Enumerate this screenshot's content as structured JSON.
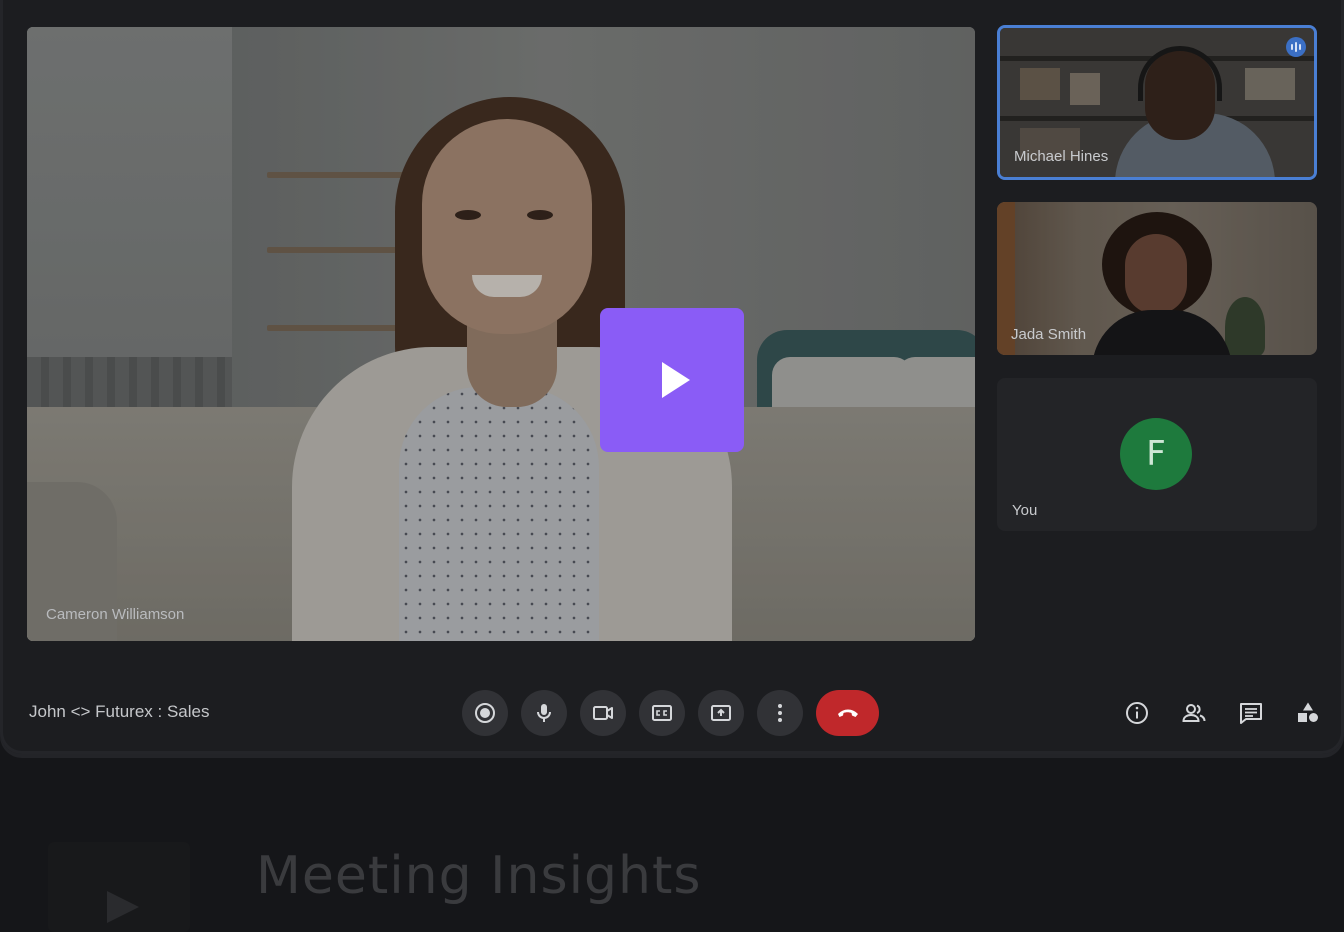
{
  "meeting": {
    "title": "John <> Futurex : Sales"
  },
  "main_video": {
    "participant": "Cameron Williamson"
  },
  "play_button": {
    "icon": "play-icon",
    "color": "#8a5cf6"
  },
  "participants": [
    {
      "name": "Michael Hines",
      "speaking": true
    },
    {
      "name": "Jada Smith",
      "speaking": false
    },
    {
      "name": "You",
      "avatar_letter": "F",
      "avatar_color": "#1e7a3d"
    }
  ],
  "controls": [
    {
      "name": "record",
      "icon": "record-icon"
    },
    {
      "name": "microphone",
      "icon": "microphone-icon"
    },
    {
      "name": "camera",
      "icon": "camera-icon"
    },
    {
      "name": "captions",
      "icon": "captions-icon"
    },
    {
      "name": "present",
      "icon": "present-screen-icon"
    },
    {
      "name": "more",
      "icon": "more-vertical-icon"
    },
    {
      "name": "end-call",
      "icon": "hang-up-icon",
      "color": "#c0282b"
    }
  ],
  "side_actions": [
    {
      "name": "info",
      "icon": "info-icon"
    },
    {
      "name": "people",
      "icon": "people-icon"
    },
    {
      "name": "chat",
      "icon": "chat-icon"
    },
    {
      "name": "activities",
      "icon": "activities-icon"
    }
  ],
  "lower_section": {
    "title": "Meeting Insights"
  }
}
